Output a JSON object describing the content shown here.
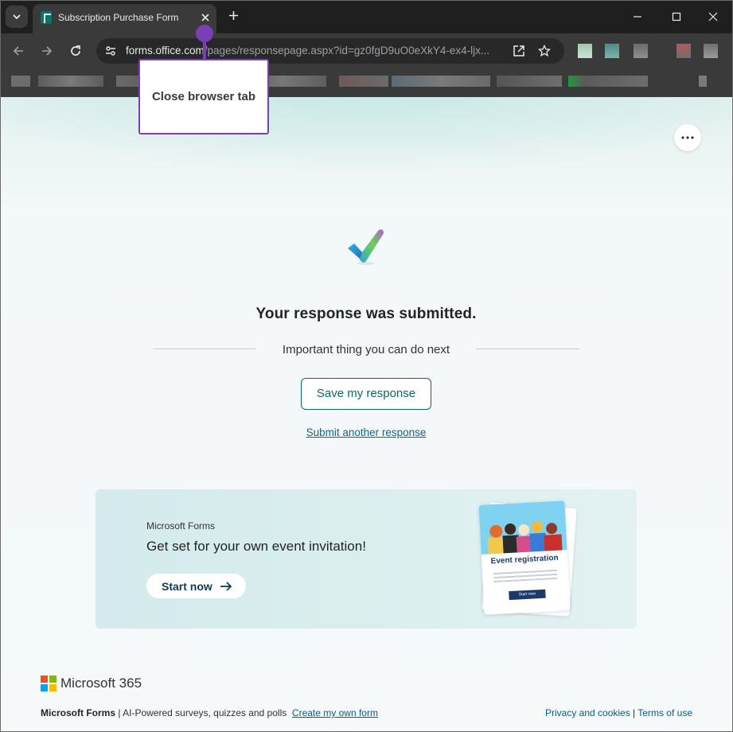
{
  "browser": {
    "tab_title": "Subscription Purchase Form",
    "url_host": "forms.office.com",
    "url_rest": "/pages/responsepage.aspx?id=gz0fgD9uO0eXkY4-ex4-ljx..."
  },
  "tooltip": {
    "label": "Close browser tab"
  },
  "confirmation": {
    "heading": "Your response was submitted.",
    "next_label": "Important thing you can do next",
    "save_button": "Save my response",
    "another_link": "Submit another response"
  },
  "promo": {
    "brand": "Microsoft Forms",
    "title": "Get set for your own event invitation!",
    "button": "Start now",
    "card_title": "Event registration",
    "card_button": "Start now"
  },
  "footer": {
    "logo_text": "Microsoft 365",
    "product": "Microsoft Forms",
    "separator": " | ",
    "tagline": "AI-Powered surveys, quizzes and polls",
    "create_link": "Create my own form",
    "privacy": "Privacy and cookies",
    "right_separator": " | ",
    "terms": "Terms of use"
  },
  "colors": {
    "accent": "#0b6a63",
    "tooltip_border": "#7b3fb5",
    "link": "#0b6a8a"
  },
  "icons": [
    "chevron-down-icon",
    "forms-favicon-icon",
    "close-icon",
    "plus-icon",
    "minimize-icon",
    "maximize-icon",
    "back-arrow-icon",
    "forward-arrow-icon",
    "reload-icon",
    "site-info-icon",
    "open-in-app-icon",
    "star-icon",
    "more-icon",
    "checkmark-icon",
    "arrow-right-icon",
    "microsoft-logo-icon"
  ]
}
